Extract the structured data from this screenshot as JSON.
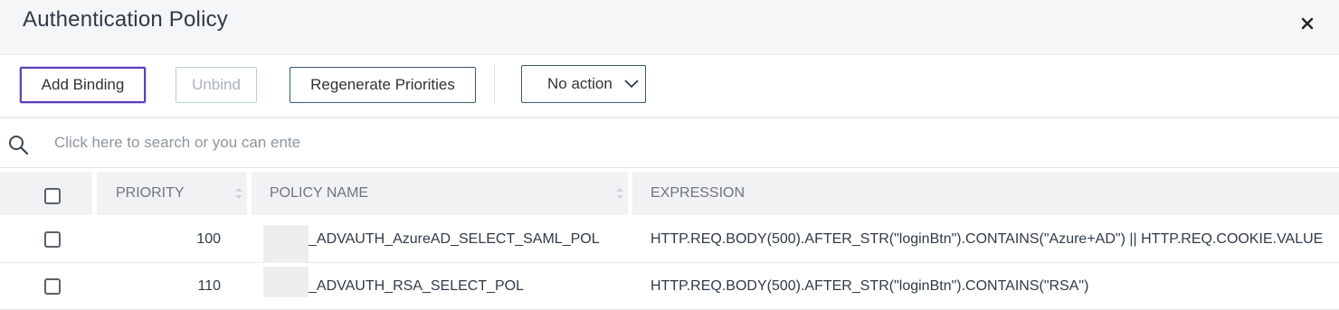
{
  "dialog": {
    "title": "Authentication Policy"
  },
  "toolbar": {
    "add_binding": "Add Binding",
    "unbind": "Unbind",
    "regenerate": "Regenerate Priorities",
    "action_select": "No action"
  },
  "search": {
    "placeholder": "Click here to search or you can ente"
  },
  "table": {
    "headers": {
      "priority": "PRIORITY",
      "policy_name": "POLICY NAME",
      "expression": "EXPRESSION"
    },
    "rows": [
      {
        "priority": "100",
        "policy_name": "_ADVAUTH_AzureAD_SELECT_SAML_POL",
        "expression": "HTTP.REQ.BODY(500).AFTER_STR(\"loginBtn\").CONTAINS(\"Azure+AD\") || HTTP.REQ.COOKIE.VALUE"
      },
      {
        "priority": "110",
        "policy_name": "_ADVAUTH_RSA_SELECT_POL",
        "expression": "HTTP.REQ.BODY(500).AFTER_STR(\"loginBtn\").CONTAINS(\"RSA\")"
      }
    ]
  },
  "icons": {
    "close": "close-icon",
    "search": "search-icon",
    "chevron": "chevron-down-icon",
    "sort": "sort-icon"
  },
  "colors": {
    "focus_border": "#5b3fb5",
    "button_border": "#3b5b6b",
    "header_bg": "#f5f6f7"
  }
}
